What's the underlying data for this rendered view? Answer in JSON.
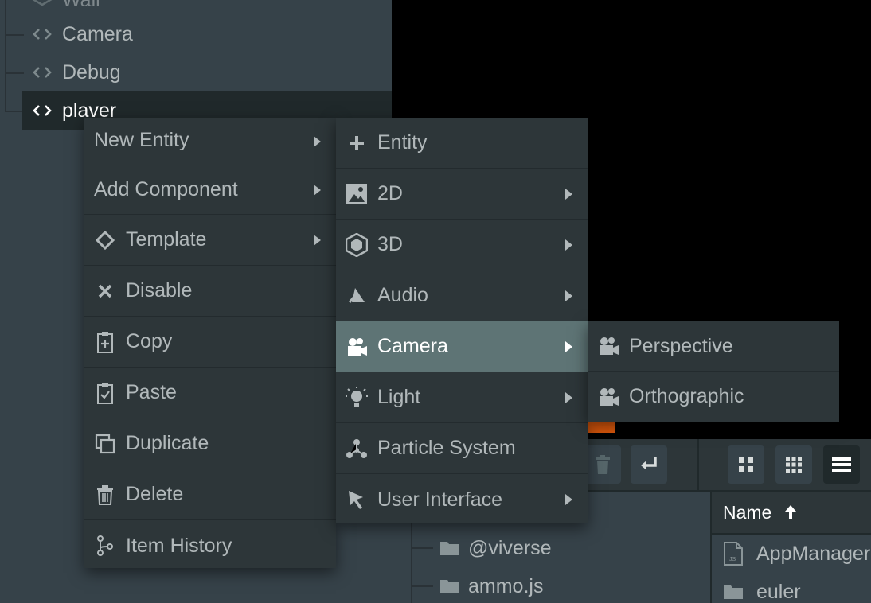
{
  "hierarchy": {
    "items": [
      {
        "label": "Wall"
      },
      {
        "label": "Camera"
      },
      {
        "label": "Debug"
      },
      {
        "label": "plaver"
      }
    ]
  },
  "context_menu": {
    "items": [
      {
        "label": "New Entity",
        "has_submenu": true
      },
      {
        "label": "Add Component",
        "has_submenu": true
      },
      {
        "label": "Template",
        "icon": "template-diamond-icon",
        "has_submenu": true
      },
      {
        "label": "Disable",
        "icon": "x-icon"
      },
      {
        "label": "Copy",
        "icon": "clipboard-plus-icon"
      },
      {
        "label": "Paste",
        "icon": "clipboard-check-icon"
      },
      {
        "label": "Duplicate",
        "icon": "duplicate-icon"
      },
      {
        "label": "Delete",
        "icon": "trash-icon"
      },
      {
        "label": "Item History",
        "icon": "branch-icon"
      }
    ]
  },
  "new_entity_menu": {
    "items": [
      {
        "label": "Entity",
        "icon": "plus-icon"
      },
      {
        "label": "2D",
        "icon": "image-icon",
        "has_submenu": true
      },
      {
        "label": "3D",
        "icon": "hexagon-icon",
        "has_submenu": true
      },
      {
        "label": "Audio",
        "icon": "audio-icon",
        "has_submenu": true
      },
      {
        "label": "Camera",
        "icon": "camera-icon",
        "has_submenu": true,
        "highlighted": true
      },
      {
        "label": "Light",
        "icon": "light-bulb-icon",
        "has_submenu": true
      },
      {
        "label": "Particle System",
        "icon": "particles-icon"
      },
      {
        "label": "User Interface",
        "icon": "cursor-icon",
        "has_submenu": true
      }
    ]
  },
  "camera_menu": {
    "items": [
      {
        "label": "Perspective",
        "icon": "camera-icon"
      },
      {
        "label": "Orthographic",
        "icon": "camera-icon"
      }
    ]
  },
  "assets": {
    "folders": [
      {
        "label": "@viverse"
      },
      {
        "label": "ammo.js"
      }
    ],
    "column_header": "Name",
    "files": [
      {
        "label": "AppManager",
        "icon": "js-file-icon"
      },
      {
        "label": "euler",
        "icon": "folder-icon"
      }
    ]
  },
  "colors": {
    "panel": "#364249",
    "menu": "#2d3639",
    "highlight": "#5e7475",
    "selected": "#20292b"
  }
}
